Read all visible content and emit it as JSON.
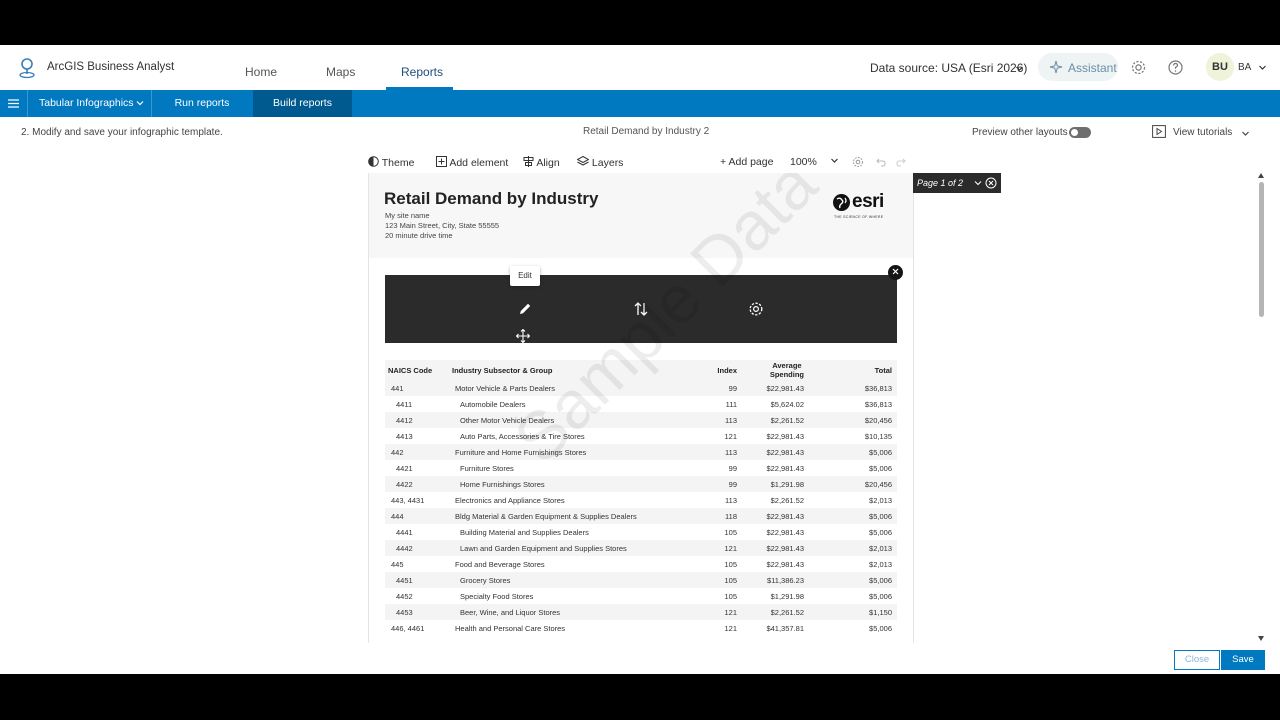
{
  "app": {
    "title": "ArcGIS Business Analyst",
    "nav_tabs": [
      {
        "label": "Home"
      },
      {
        "label": "Maps"
      },
      {
        "label": "Reports"
      }
    ],
    "data_source": "Data source: USA (Esri 2026)",
    "assistant_label": "Assistant",
    "user_initials": "BU",
    "user_label": "BA"
  },
  "bluebar": {
    "report_type": "Tabular Infographics",
    "run_reports": "Run reports",
    "build_reports": "Build reports"
  },
  "subheader": {
    "step": "2.  Modify and save your infographic template.",
    "doc_title": "Retail Demand by Industry 2",
    "preview_label": "Preview other layouts",
    "tutorials_label": "View tutorials"
  },
  "toolbar": {
    "theme": "Theme",
    "add_element": "Add element",
    "align": "Align",
    "layers": "Layers",
    "add_page": "Add page",
    "zoom": "100%"
  },
  "report": {
    "title": "Retail Demand by Industry",
    "site_name": "My site name",
    "address": "123 Main Street, City, State 55555",
    "drive_time": "20 minute drive time",
    "logo_text": "esri",
    "logo_tagline": "THE SCIENCE OF WHERE",
    "edit_tooltip": "Edit",
    "watermark": "Sample Data",
    "page_badge": "Page 1 of 2"
  },
  "table": {
    "headers": {
      "code": "NAICS Code",
      "industry": "Industry Subsector & Group",
      "index": "Index",
      "avg_line1": "Average",
      "avg_line2": "Spending",
      "total": "Total"
    },
    "rows": [
      {
        "code": "441",
        "industry": "Motor Vehicle & Parts Dealers",
        "index": "99",
        "avg": "$22,981.43",
        "total": "$36,813",
        "sub": false
      },
      {
        "code": "4411",
        "industry": "Automobile Dealers",
        "index": "111",
        "avg": "$5,624.02",
        "total": "$36,813",
        "sub": true
      },
      {
        "code": "4412",
        "industry": "Other Motor Vehicle Dealers",
        "index": "113",
        "avg": "$2,261.52",
        "total": "$20,456",
        "sub": true
      },
      {
        "code": "4413",
        "industry": "Auto Parts, Accessories & Tire Stores",
        "index": "121",
        "avg": "$22,981.43",
        "total": "$10,135",
        "sub": true
      },
      {
        "code": "442",
        "industry": "Furniture and Home Furnishings Stores",
        "index": "113",
        "avg": "$22,981.43",
        "total": "$5,006",
        "sub": false
      },
      {
        "code": "4421",
        "industry": "Furniture Stores",
        "index": "99",
        "avg": "$22,981.43",
        "total": "$5,006",
        "sub": true
      },
      {
        "code": "4422",
        "industry": "Home Furnishings Stores",
        "index": "99",
        "avg": "$1,291.98",
        "total": "$20,456",
        "sub": true
      },
      {
        "code": "443, 4431",
        "industry": "Electronics and Appliance Stores",
        "index": "113",
        "avg": "$2,261.52",
        "total": "$2,013",
        "sub": false
      },
      {
        "code": "444",
        "industry": "Bldg Material & Garden Equipment & Supplies Dealers",
        "index": "118",
        "avg": "$22,981.43",
        "total": "$5,006",
        "sub": false
      },
      {
        "code": "4441",
        "industry": "Building Material and Supplies Dealers",
        "index": "105",
        "avg": "$22,981.43",
        "total": "$5,006",
        "sub": true
      },
      {
        "code": "4442",
        "industry": "Lawn and Garden Equipment and Supplies Stores",
        "index": "121",
        "avg": "$22,981.43",
        "total": "$2,013",
        "sub": true
      },
      {
        "code": "445",
        "industry": "Food and Beverage Stores",
        "index": "105",
        "avg": "$22,981.43",
        "total": "$2,013",
        "sub": false
      },
      {
        "code": "4451",
        "industry": "Grocery Stores",
        "index": "105",
        "avg": "$11,386.23",
        "total": "$5,006",
        "sub": true
      },
      {
        "code": "4452",
        "industry": "Specialty Food Stores",
        "index": "105",
        "avg": "$1,291.98",
        "total": "$5,006",
        "sub": true
      },
      {
        "code": "4453",
        "industry": "Beer, Wine, and Liquor Stores",
        "index": "121",
        "avg": "$2,261.52",
        "total": "$1,150",
        "sub": true
      },
      {
        "code": "446, 4461",
        "industry": "Health and Personal Care Stores",
        "index": "121",
        "avg": "$41,357.81",
        "total": "$5,006",
        "sub": false
      }
    ]
  },
  "footer": {
    "close": "Close",
    "save": "Save"
  },
  "colors": {
    "brand_blue": "#0079c1",
    "brand_blue_dark": "#005a8f",
    "panel_dark": "#2b2b2b"
  }
}
